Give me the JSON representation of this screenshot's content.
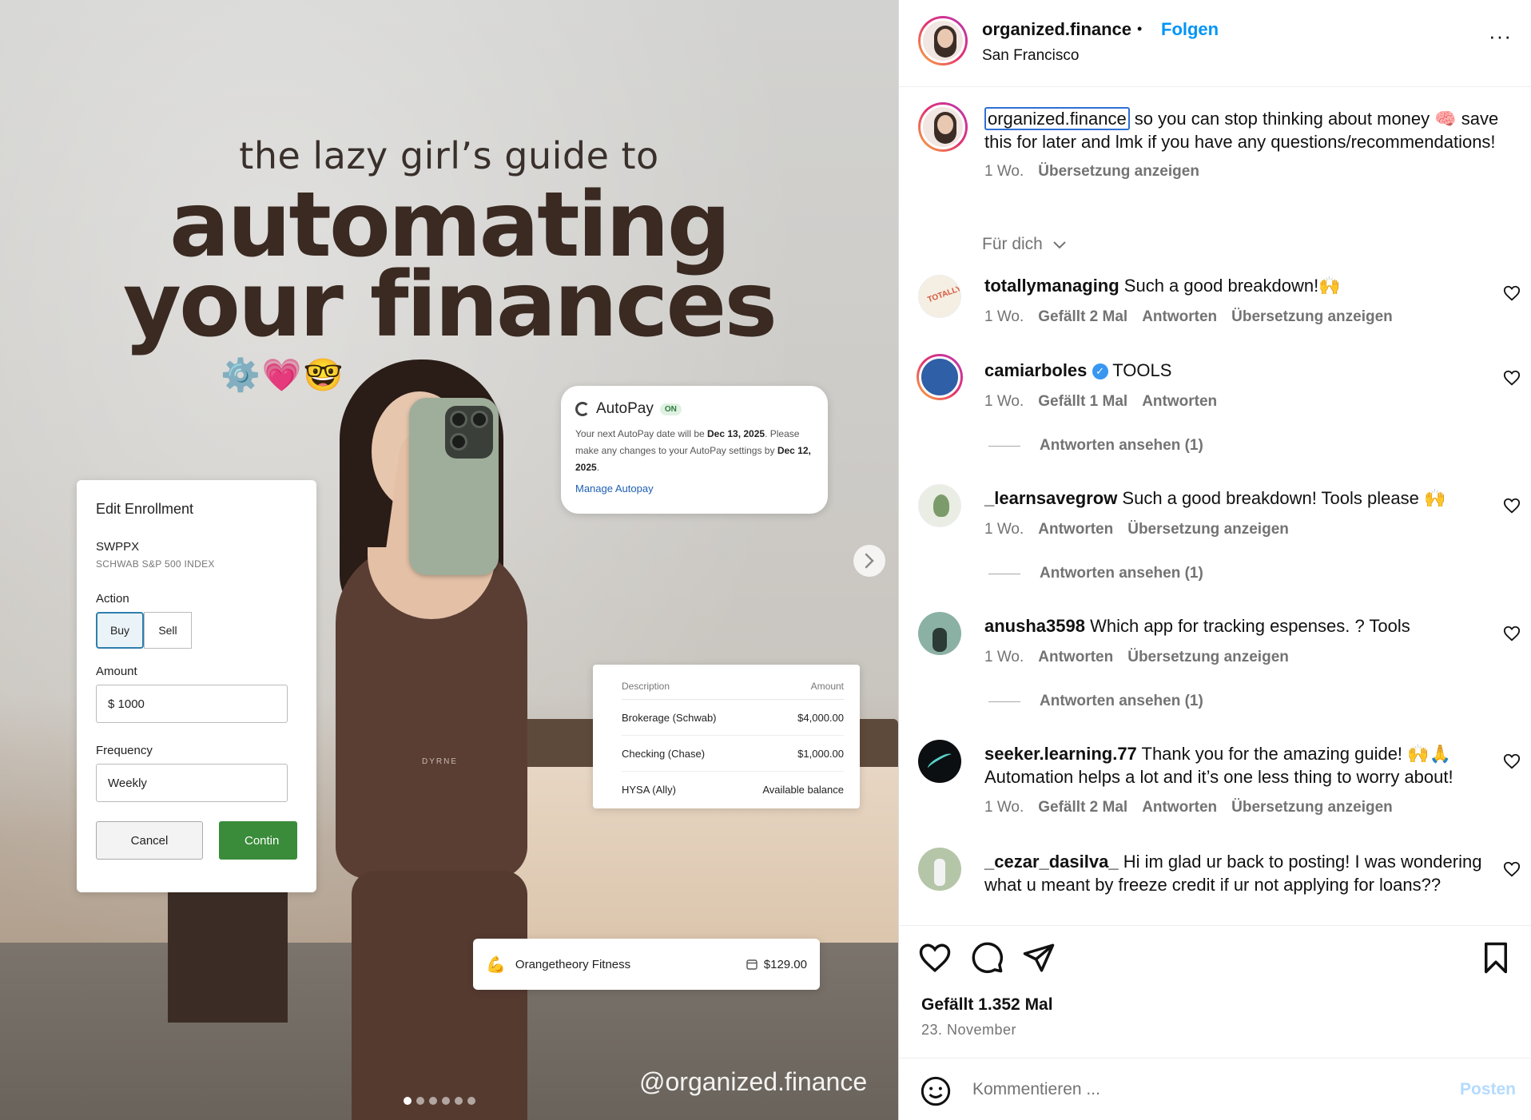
{
  "post_image": {
    "subtitle": "the lazy girl’s guide to",
    "title_line1": "automating",
    "title_line2": "your finances",
    "emojis": "⚙️💗🤓",
    "autopay": {
      "title": "AutoPay",
      "badge": "ON",
      "body_1": "Your next AutoPay date will be ",
      "date_1": "Dec 13, 2025",
      "body_2": ". Please make any changes to your AutoPay settings by ",
      "date_2": "Dec 12, 2025",
      "link": "Manage Autopay"
    },
    "enroll": {
      "title": "Edit Enrollment",
      "fund": "SWPPX",
      "fund_name": "SCHWAB S&P 500 INDEX",
      "action_label": "Action",
      "buy": "Buy",
      "sell": "Sell",
      "amount_label": "Amount",
      "amount_value": "$ 1000",
      "frequency_label": "Frequency",
      "frequency_value": "Weekly",
      "cancel": "Cancel",
      "continue": "Contin"
    },
    "table": {
      "col_desc": "Description",
      "col_amount": "Amount",
      "rows": [
        {
          "desc": "Brokerage (Schwab)",
          "amount": "$4,000.00"
        },
        {
          "desc": "Checking (Chase)",
          "amount": "$1,000.00"
        },
        {
          "desc": "HYSA (Ally)",
          "amount": "Available balance"
        }
      ]
    },
    "fitness": {
      "icon": "💪",
      "name": "Orangetheory Fitness",
      "amount": "$129.00"
    },
    "shirt_brand": "DYRNE",
    "watermark": "@organized.finance",
    "slide_count": 6,
    "active_slide": 1
  },
  "header": {
    "username": "organized.finance",
    "separator": "•",
    "follow": "Folgen",
    "location": "San Francisco",
    "more": "···"
  },
  "caption": {
    "username": "organized.finance",
    "text": " so you can stop thinking about money 🧠 save this for later and lmk if you have any questions/recommendations!",
    "time": "1 Wo.",
    "translate": "Übersetzung anzeigen"
  },
  "for_you": "Für dich",
  "comments": [
    {
      "user": "totallymanaging",
      "text": " Such a good breakdown!🙌",
      "time": "1 Wo.",
      "likes": "Gefällt 2 Mal",
      "reply": "Antworten",
      "translate": "Übersetzung anzeigen"
    },
    {
      "user": "camiarboles",
      "verified": "✓",
      "text": " TOOLS",
      "time": "1 Wo.",
      "likes": "Gefällt 1 Mal",
      "reply": "Antworten",
      "view_replies": "Antworten ansehen (1)"
    },
    {
      "user": "_learnsavegrow",
      "text": " Such a good breakdown! Tools please 🙌",
      "time": "1 Wo.",
      "reply": "Antworten",
      "translate": "Übersetzung anzeigen",
      "view_replies": "Antworten ansehen (1)"
    },
    {
      "user": "anusha3598",
      "text": " Which app for tracking espenses. ? Tools",
      "time": "1 Wo.",
      "reply": "Antworten",
      "translate": "Übersetzung anzeigen",
      "view_replies": "Antworten ansehen (1)"
    },
    {
      "user": "seeker.learning.77",
      "text": " Thank you for the amazing guide! 🙌🙏 Automation helps a lot and it’s one less thing to worry about!",
      "time": "1 Wo.",
      "likes": "Gefällt 2 Mal",
      "reply": "Antworten",
      "translate": "Übersetzung anzeigen"
    },
    {
      "user": "_cezar_dasilva_",
      "text": " Hi im glad ur back to posting! I was wondering what u meant by freeze credit if ur not applying for loans??"
    }
  ],
  "actions": {
    "likes": "Gefällt 1.352 Mal",
    "date": "23. November"
  },
  "composer": {
    "placeholder": "Kommentieren ...",
    "post": "Posten"
  },
  "colors": {
    "link_blue": "#0095f6",
    "muted": "#737373",
    "verified": "#3897f0"
  }
}
